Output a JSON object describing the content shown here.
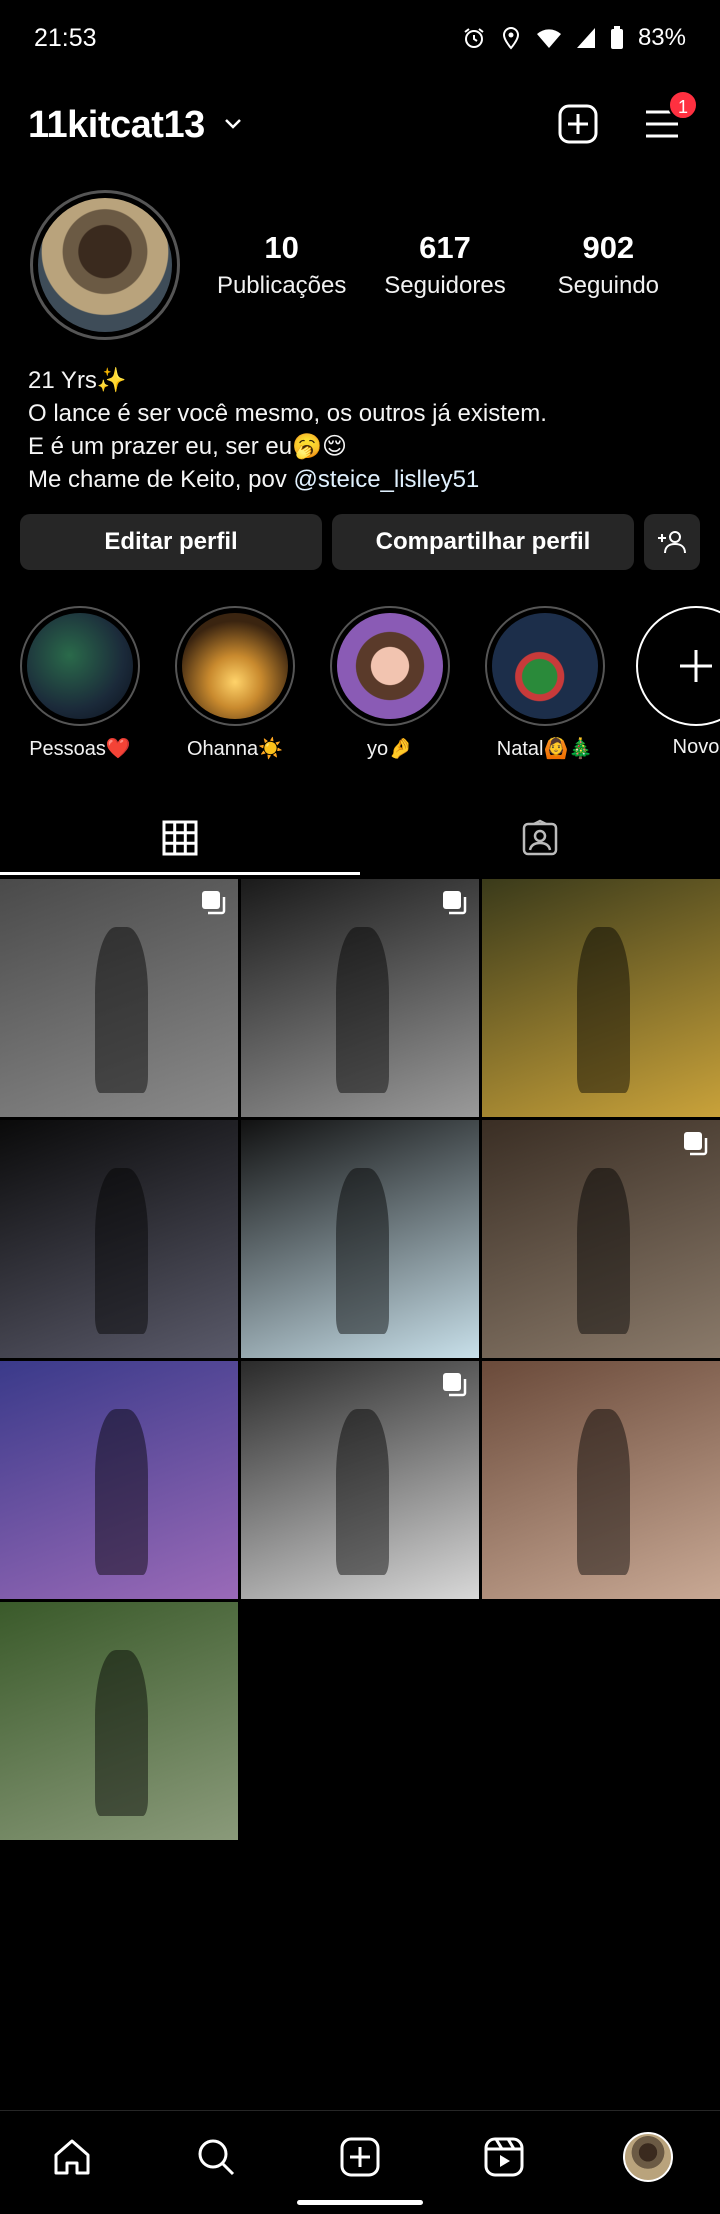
{
  "status_bar": {
    "time": "21:53",
    "battery": "83%"
  },
  "header": {
    "username": "11kitcat13",
    "notification_count": "1"
  },
  "profile": {
    "stats": [
      {
        "value": "10",
        "label": "Publicações"
      },
      {
        "value": "617",
        "label": "Seguidores"
      },
      {
        "value": "902",
        "label": "Seguindo"
      }
    ],
    "bio": {
      "line1": "21 Yrs✨",
      "line2": "O lance é ser você mesmo, os outros já existem.",
      "line3": "E é um prazer eu, ser eu🥱😌",
      "line4_prefix": "Me chame de Keito, pov ",
      "line4_mention": "@steice_lislley51"
    }
  },
  "actions": {
    "edit": "Editar perfil",
    "share": "Compartilhar perfil"
  },
  "highlights": [
    {
      "label": "Pessoas❤️",
      "color": "#1b2a3a"
    },
    {
      "label": "Ohanna☀️",
      "color": "#c98a2e"
    },
    {
      "label": "yo🤌",
      "color": "#8a5bb5"
    },
    {
      "label": "Natal🙆🎄",
      "color": "#1c2e4a"
    },
    {
      "label": "Novo",
      "color": "#000000"
    }
  ],
  "posts": [
    {
      "id": "1",
      "multi": true,
      "colors": [
        "#4a4a4a",
        "#8a8a8a"
      ]
    },
    {
      "id": "2",
      "multi": true,
      "colors": [
        "#1a1a1a",
        "#9a9a9a"
      ]
    },
    {
      "id": "3",
      "multi": false,
      "colors": [
        "#3a3a1a",
        "#c9a23a"
      ]
    },
    {
      "id": "4",
      "multi": false,
      "colors": [
        "#0a0a0a",
        "#5a5a6a"
      ]
    },
    {
      "id": "5",
      "multi": false,
      "colors": [
        "#111111",
        "#c8e0ea"
      ]
    },
    {
      "id": "6",
      "multi": true,
      "colors": [
        "#3a2e24",
        "#8a7a6a"
      ]
    },
    {
      "id": "7",
      "multi": false,
      "colors": [
        "#3a3a8a",
        "#9a6ab8"
      ]
    },
    {
      "id": "8",
      "multi": true,
      "colors": [
        "#2a2a2a",
        "#d8d8d8"
      ]
    },
    {
      "id": "9",
      "multi": false,
      "colors": [
        "#6a4a3a",
        "#c8a894"
      ]
    },
    {
      "id": "10",
      "multi": false,
      "colors": [
        "#3a5a2a",
        "#8a9a7a"
      ]
    }
  ]
}
